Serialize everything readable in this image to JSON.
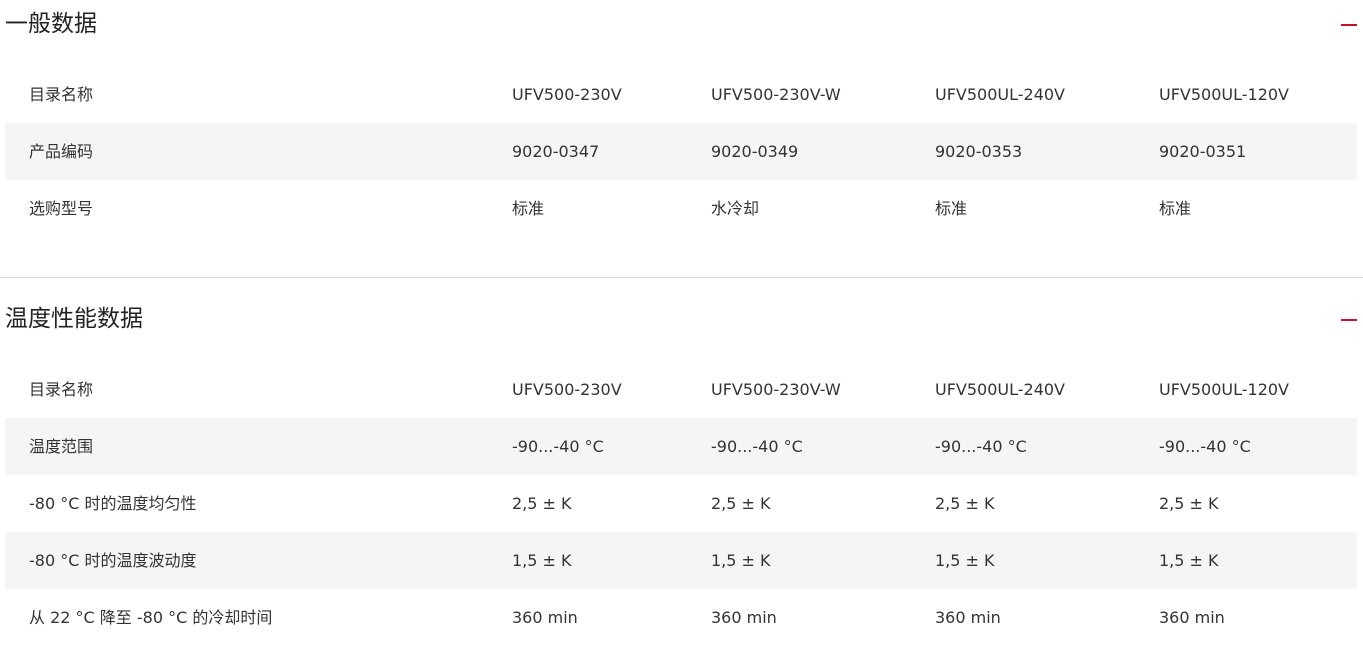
{
  "sections": [
    {
      "title": "一般数据",
      "rows": [
        [
          "目录名称",
          "UFV500-230V",
          "UFV500-230V-W",
          "UFV500UL-240V",
          "UFV500UL-120V"
        ],
        [
          "产品编码",
          "9020-0347",
          "9020-0349",
          "9020-0353",
          "9020-0351"
        ],
        [
          "选购型号",
          "标准",
          "水冷却",
          "标准",
          "标准"
        ]
      ]
    },
    {
      "title": "温度性能数据",
      "rows": [
        [
          "目录名称",
          "UFV500-230V",
          "UFV500-230V-W",
          "UFV500UL-240V",
          "UFV500UL-120V"
        ],
        [
          "温度范围",
          "-90...-40 °C",
          "-90...-40 °C",
          "-90...-40 °C",
          "-90...-40 °C"
        ],
        [
          "-80 °C 时的温度均匀性",
          "2,5 ± K",
          "2,5 ± K",
          "2,5 ± K",
          "2,5 ± K"
        ],
        [
          "-80 °C 时的温度波动度",
          "1,5 ± K",
          "1,5 ± K",
          "1,5 ± K",
          "1,5 ± K"
        ],
        [
          "从 22 °C 降至 -80 °C 的冷却时间",
          "360 min",
          "360 min",
          "360 min",
          "360 min"
        ]
      ]
    }
  ],
  "colors": {
    "accent": "#c8102e",
    "row_shade": "#f5f5f5",
    "divider": "#dddddd",
    "text": "#333333"
  },
  "icons": {
    "collapse": "minus-icon"
  }
}
